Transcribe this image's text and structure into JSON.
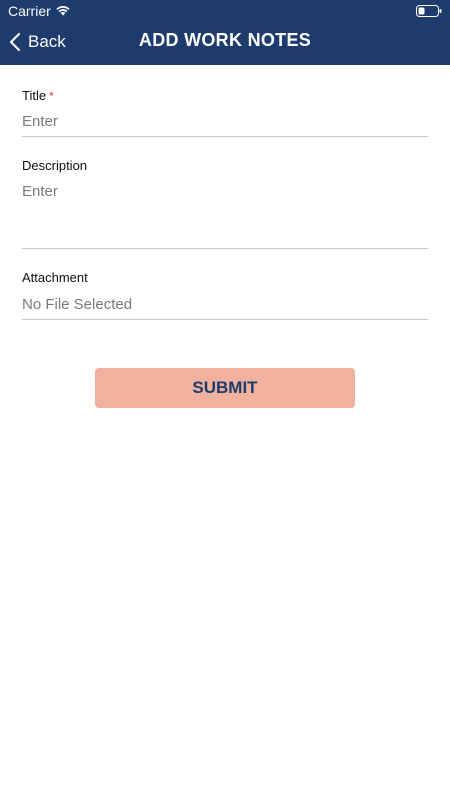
{
  "status_bar": {
    "carrier": "Carrier"
  },
  "nav": {
    "back_label": "Back",
    "title": "ADD WORK NOTES"
  },
  "form": {
    "title_label": "Title",
    "title_required_mark": "*",
    "title_placeholder": "Enter",
    "description_label": "Description",
    "description_placeholder": "Enter",
    "attachment_label": "Attachment",
    "attachment_value": "No File Selected"
  },
  "submit_label": "SUBMIT",
  "colors": {
    "header_bg": "#1d3b6c",
    "submit_bg": "#f0b29f",
    "required": "#e23b2e"
  }
}
